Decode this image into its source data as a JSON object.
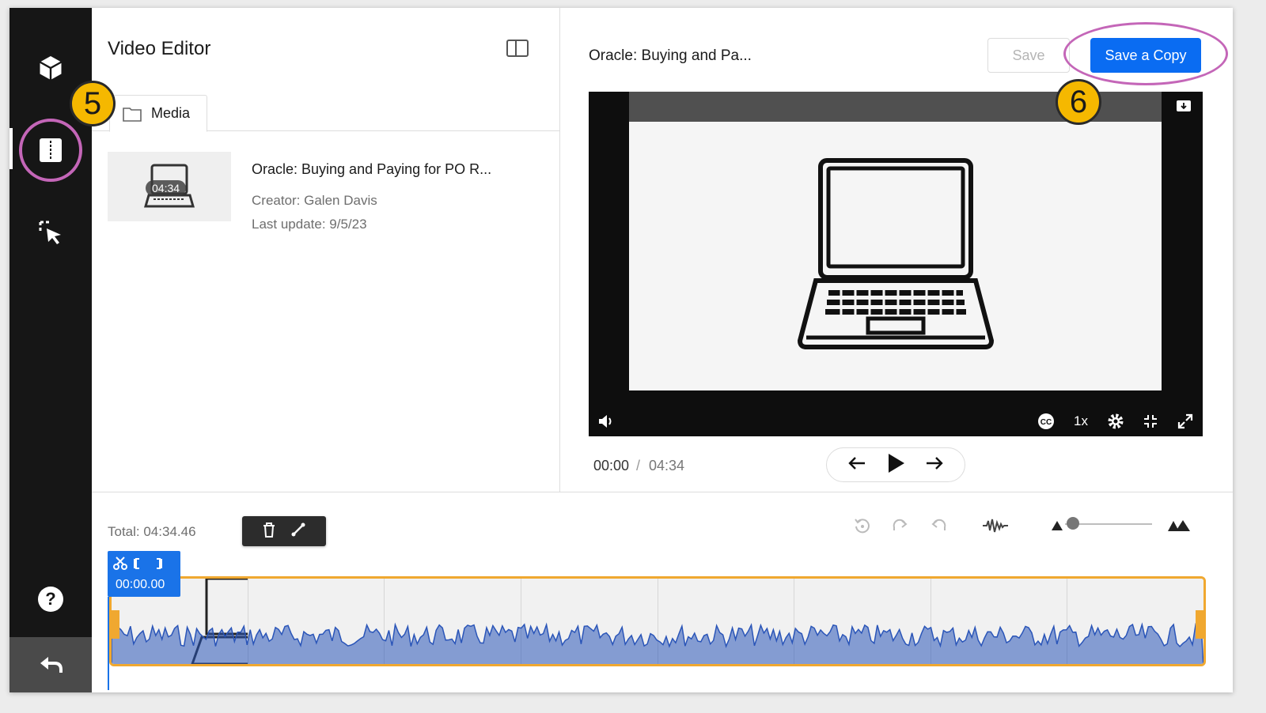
{
  "app": {
    "title": "Video Editor"
  },
  "tabs": [
    {
      "label": "Media"
    }
  ],
  "media": {
    "title": "Oracle: Buying and Paying for PO R...",
    "duration": "04:34",
    "creator": "Creator: Galen Davis",
    "updated": "Last update: 9/5/23"
  },
  "video": {
    "title": "Oracle: Buying and Pa...",
    "current_time": "00:00",
    "separator": "/",
    "total_time": "04:34",
    "speed": "1x",
    "cc": "CC"
  },
  "actions": {
    "save": "Save",
    "save_copy": "Save a Copy"
  },
  "timeline": {
    "total": "Total: 04:34.46",
    "cursor_time": "00:00.00",
    "zoom_level": 0.02
  },
  "callouts": {
    "step5": "5",
    "step6": "6"
  },
  "colors": {
    "rail": "#161616",
    "accent_blue": "#0a6cf2",
    "clip_border": "#f0a830",
    "waveform": "#2a55b8",
    "callout_fill": "#f5b800",
    "highlight_ring": "#c466b8"
  }
}
